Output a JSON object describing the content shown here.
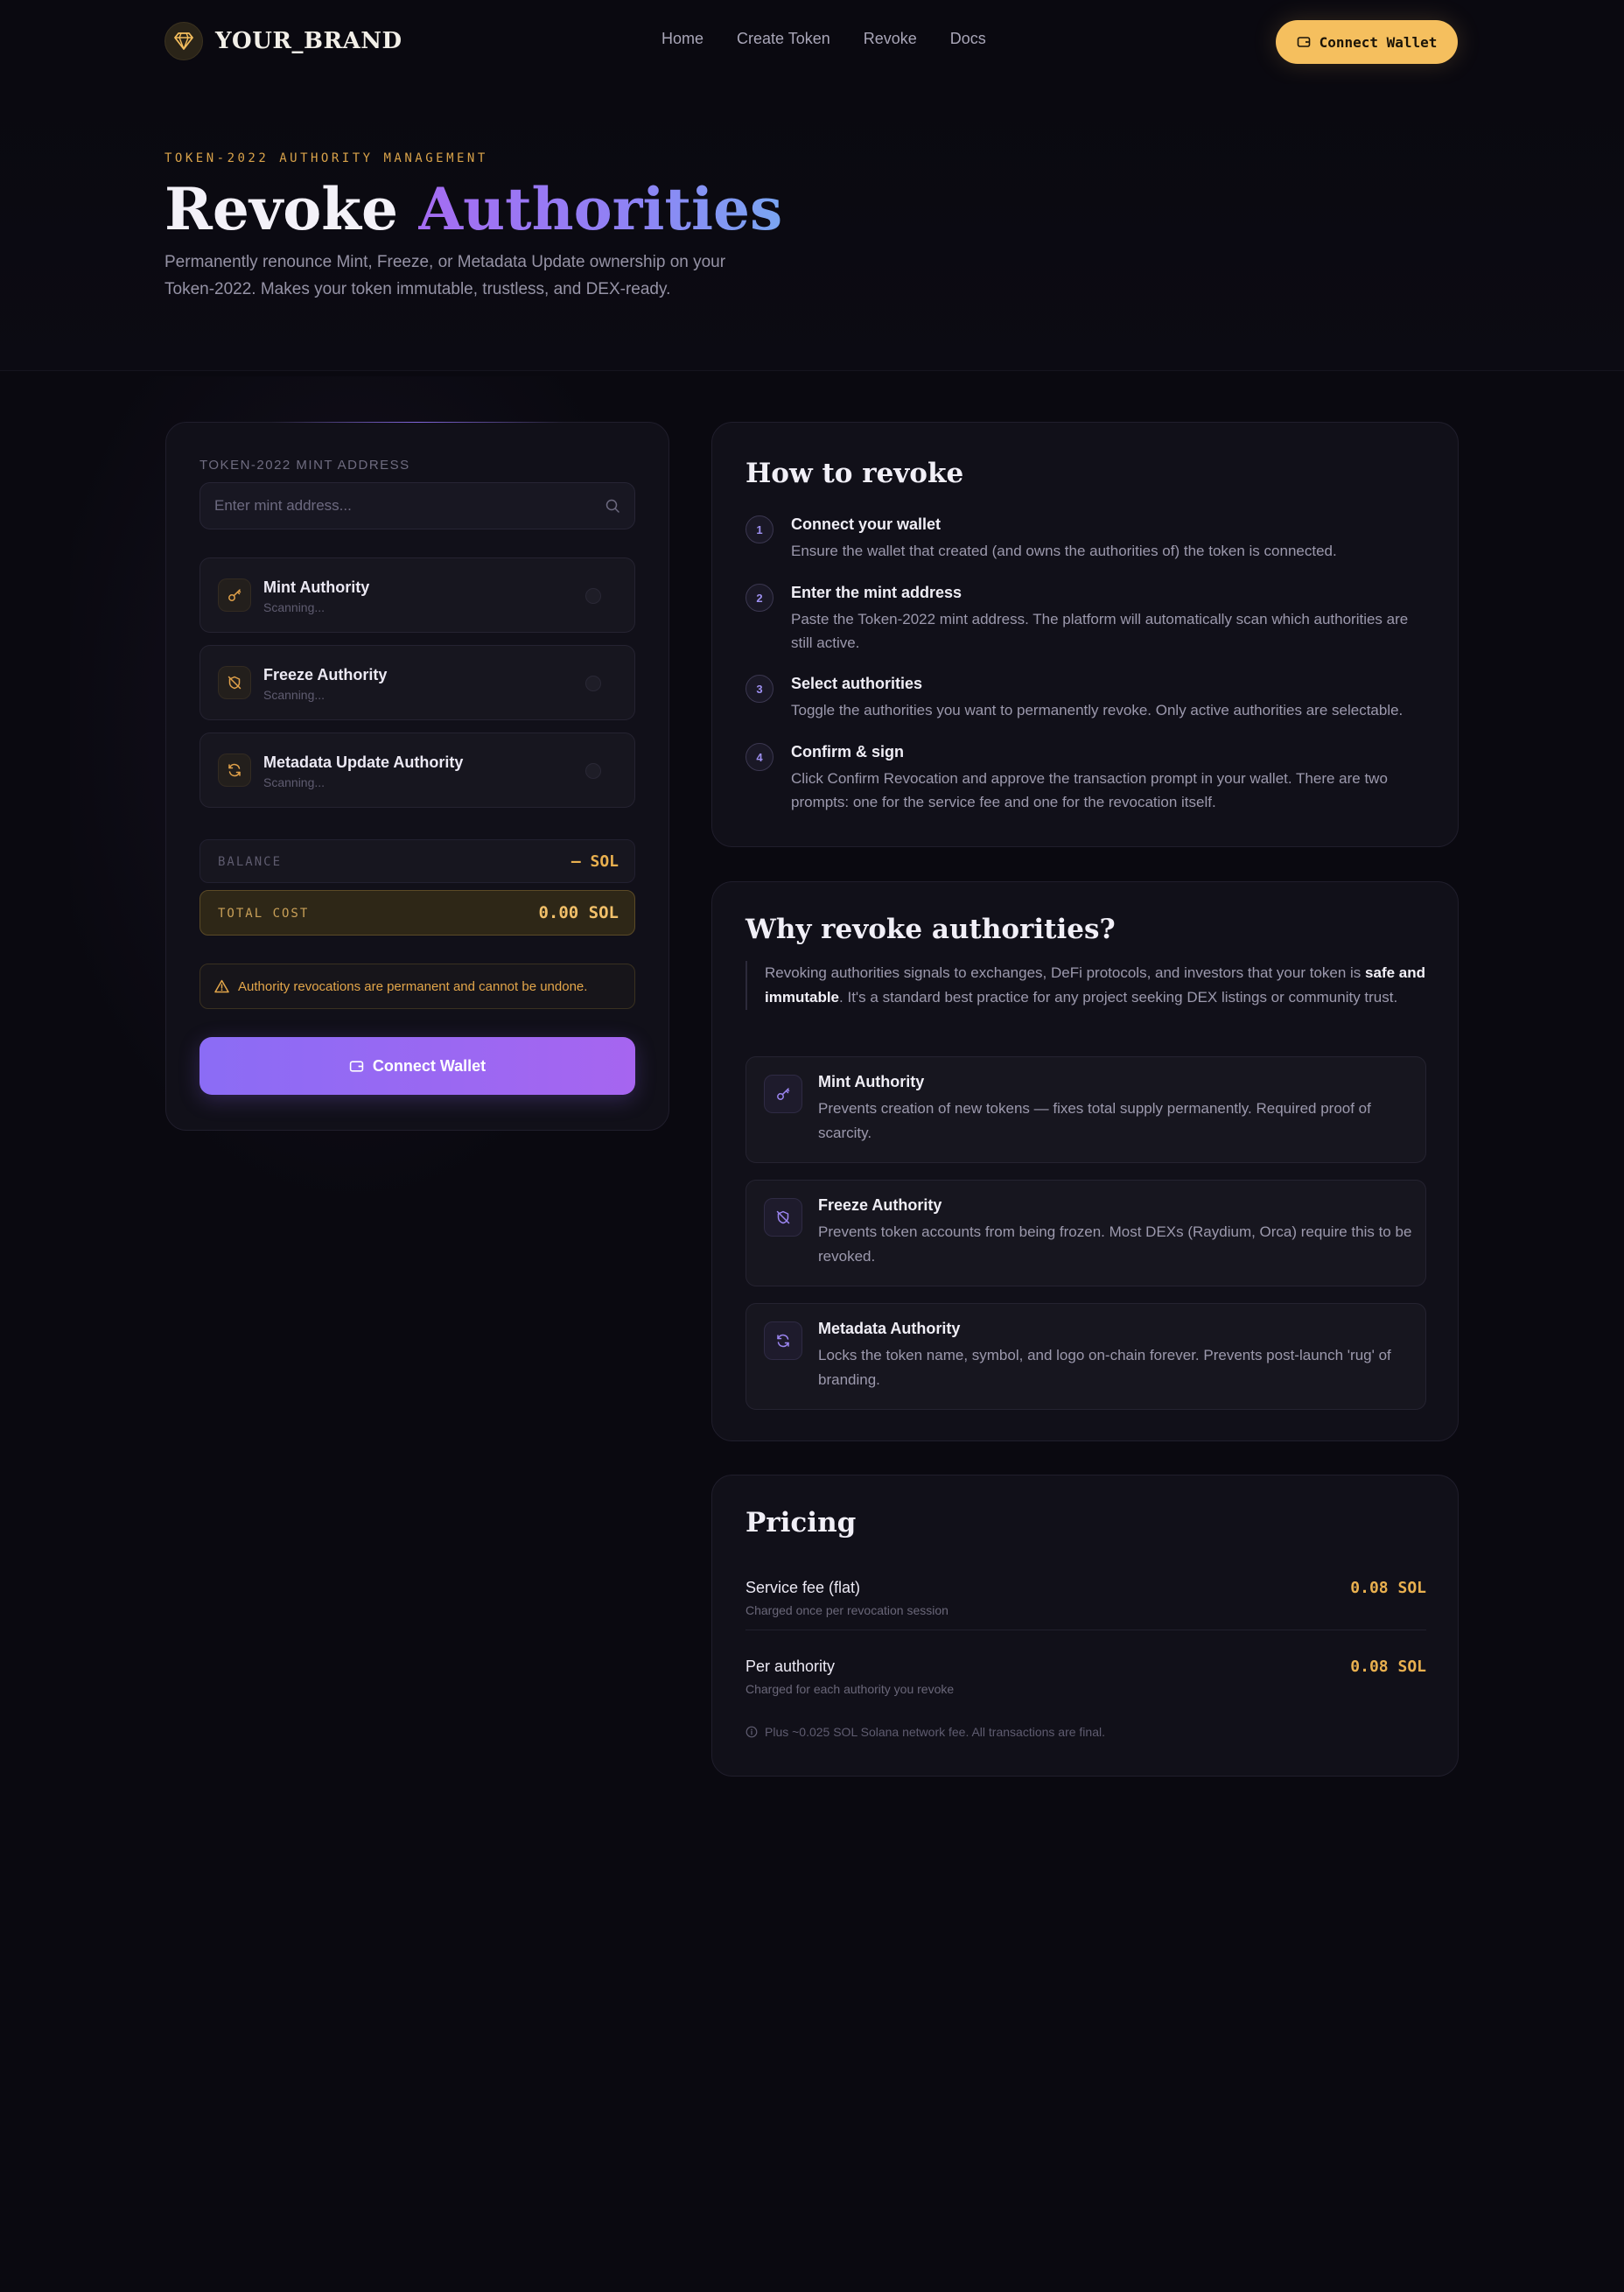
{
  "nav": {
    "brand": "YOUR_BRAND",
    "links": [
      "Home",
      "Create Token",
      "Revoke",
      "Docs"
    ],
    "connect_label": "Connect Wallet"
  },
  "hero": {
    "eyebrow": "TOKEN-2022 AUTHORITY MANAGEMENT",
    "title_plain": "Revoke ",
    "title_accent": "Authorities",
    "subtitle": "Permanently renounce Mint, Freeze, or Metadata Update ownership on your Token-2022. Makes your token immutable, trustless, and DEX-ready."
  },
  "form": {
    "mint_label": "TOKEN-2022 MINT ADDRESS",
    "mint_placeholder": "Enter mint address...",
    "mint_value": "",
    "authorities": [
      {
        "name": "Mint Authority",
        "status": "Scanning...",
        "icon": "key-icon"
      },
      {
        "name": "Freeze Authority",
        "status": "Scanning...",
        "icon": "snowflake-off-icon"
      },
      {
        "name": "Metadata Update Authority",
        "status": "Scanning...",
        "icon": "refresh-icon"
      }
    ],
    "balance_label": "BALANCE",
    "balance_value": "— SOL",
    "total_label": "TOTAL COST",
    "total_value": "0.00 SOL",
    "warning": "Authority revocations are permanent and cannot be undone.",
    "cta_label": "Connect Wallet"
  },
  "how": {
    "title": "How to revoke",
    "steps": [
      {
        "num": "1",
        "title": "Connect your wallet",
        "desc": "Ensure the wallet that created (and owns the authorities of) the token is connected."
      },
      {
        "num": "2",
        "title": "Enter the mint address",
        "desc": "Paste the Token-2022 mint address. The platform will automatically scan which authorities are still active."
      },
      {
        "num": "3",
        "title": "Select authorities",
        "desc": "Toggle the authorities you want to permanently revoke. Only active authorities are selectable."
      },
      {
        "num": "4",
        "title": "Confirm & sign",
        "desc": "Click Confirm Revocation and approve the transaction prompt in your wallet. There are two prompts: one for the service fee and one for the revocation itself."
      }
    ]
  },
  "why": {
    "title": "Why revoke authorities?",
    "intro_before": "Revoking authorities signals to exchanges, DeFi protocols, and investors that your token is ",
    "intro_bold": "safe and immutable",
    "intro_after": ". It's a standard best practice for any project seeking DEX listings or community trust.",
    "items": [
      {
        "name": "Mint Authority",
        "desc": "Prevents creation of new tokens — fixes total supply permanently. Required proof of scarcity."
      },
      {
        "name": "Freeze Authority",
        "desc": "Prevents token accounts from being frozen. Most DEXs (Raydium, Orca) require this to be revoked."
      },
      {
        "name": "Metadata Authority",
        "desc": "Locks the token name, symbol, and logo on-chain forever. Prevents post-launch 'rug' of branding."
      }
    ]
  },
  "pricing": {
    "title": "Pricing",
    "rows": [
      {
        "name": "Service fee (flat)",
        "note": "Charged once per revocation session",
        "value": "0.08 SOL"
      },
      {
        "name": "Per authority",
        "note": "Charged for each authority you revoke",
        "value": "0.08 SOL"
      }
    ],
    "footnote": "Plus ~0.025 SOL Solana network fee. All transactions are final."
  },
  "colors": {
    "background": "#0a0910",
    "accent_gold": "#f5bf5e",
    "accent_purple": "#8b6cf5"
  }
}
